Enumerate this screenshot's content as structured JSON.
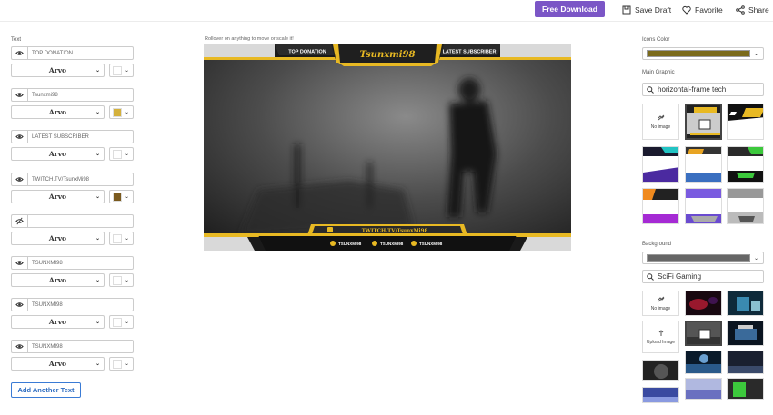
{
  "topbar": {
    "free_download": "Free Download",
    "save_draft": "Save Draft",
    "favorite": "Favorite",
    "share": "Share"
  },
  "left": {
    "section_label": "Text",
    "texts": [
      {
        "visible": true,
        "value": "TOP DONATION",
        "font": "Arvo",
        "color": "#ffffff"
      },
      {
        "visible": true,
        "value": "Tsunxmi98",
        "font": "Arvo",
        "color": "#d4b13c"
      },
      {
        "visible": true,
        "value": "LATEST SUBSCRIBER",
        "font": "Arvo",
        "color": "#ffffff"
      },
      {
        "visible": true,
        "value": "TWITCH.TV/TsunxMi98",
        "font": "Arvo",
        "color": "#7a5a1e"
      },
      {
        "visible": false,
        "value": "",
        "font": "Arvo",
        "color": "#ffffff"
      },
      {
        "visible": true,
        "value": "TSUNXMI98",
        "font": "Arvo",
        "color": "#ffffff"
      },
      {
        "visible": true,
        "value": "TSUNXMI98",
        "font": "Arvo",
        "color": "#ffffff"
      },
      {
        "visible": true,
        "value": "TSUNXMI98",
        "font": "Arvo",
        "color": "#ffffff"
      }
    ],
    "add_text": "Add Another Text"
  },
  "canvas": {
    "hint": "Rollover on anything to move or scale it!",
    "top_donation": "TOP DONATION",
    "name": "Tsunxmi98",
    "latest_subscriber": "LATEST SUBSCRIBER",
    "twitch": "TWITCH.TV/TsunxMi98",
    "socials": [
      "TSUNXMI98",
      "TSUNXMI98",
      "TSUNXMI98"
    ]
  },
  "right": {
    "icons_color_label": "Icons Color",
    "icons_color": "#7a6a1a",
    "main_graphic_label": "Main Graphic",
    "main_graphic_search": "horizontal-frame tech",
    "no_image": "No image",
    "background_label": "Background",
    "background_color": "#666666",
    "background_search": "SciFi Gaming",
    "upload_image": "Upload Image"
  },
  "colors": {
    "accent": "#7b56c6",
    "gold": "#e8b923",
    "link": "#2d6cc0"
  }
}
